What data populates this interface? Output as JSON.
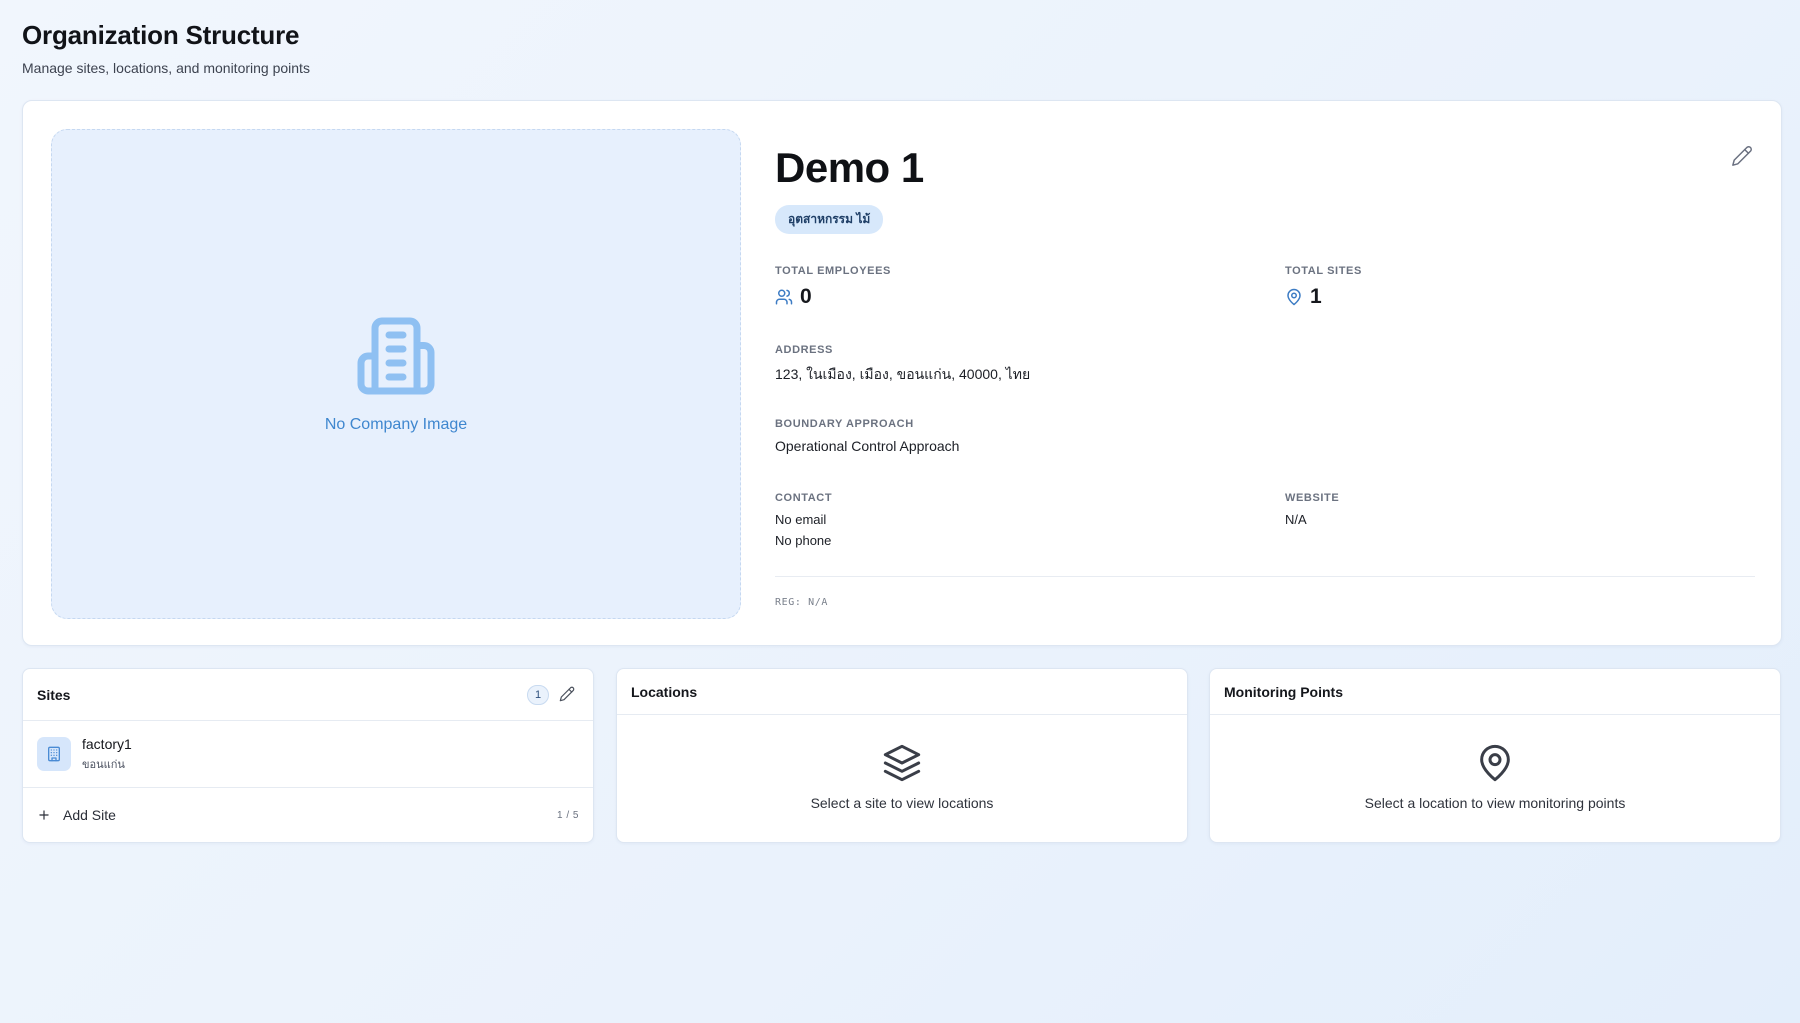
{
  "header": {
    "title": "Organization Structure",
    "subtitle": "Manage sites, locations, and monitoring points"
  },
  "company": {
    "image_placeholder_label": "No Company Image",
    "name": "Demo 1",
    "industry_badge": "อุตสาหกรรม ไม้",
    "stats": {
      "employees_label": "TOTAL EMPLOYEES",
      "employees_value": "0",
      "sites_label": "TOTAL SITES",
      "sites_value": "1"
    },
    "address_label": "ADDRESS",
    "address_value": "123, ในเมือง, เมือง, ขอนแก่น, 40000, ไทย",
    "boundary_label": "BOUNDARY APPROACH",
    "boundary_value": "Operational Control Approach",
    "contact_label": "CONTACT",
    "contact_email": "No email",
    "contact_phone": "No phone",
    "website_label": "WEBSITE",
    "website_value": "N/A",
    "reg": "REG: N/A"
  },
  "sites_panel": {
    "title": "Sites",
    "count": "1",
    "items": [
      {
        "name": "factory1",
        "province": "ขอนแก่น"
      }
    ],
    "add_label": "Add Site",
    "limit": "1 / 5"
  },
  "locations_panel": {
    "title": "Locations",
    "empty_text": "Select a site to view locations"
  },
  "monitoring_panel": {
    "title": "Monitoring Points",
    "empty_text": "Select a location to view monitoring points"
  },
  "icons": {
    "building": "building-icon",
    "users": "users-icon",
    "map_pin": "map-pin-icon",
    "pencil": "pencil-icon",
    "plus": "plus-icon",
    "layers": "layers-icon"
  },
  "colors": {
    "accent": "#3f87cf",
    "badge_bg": "#d7e8fb",
    "placeholder_bg": "#e7f0fd",
    "icon_blue": "#8fc0f2"
  }
}
